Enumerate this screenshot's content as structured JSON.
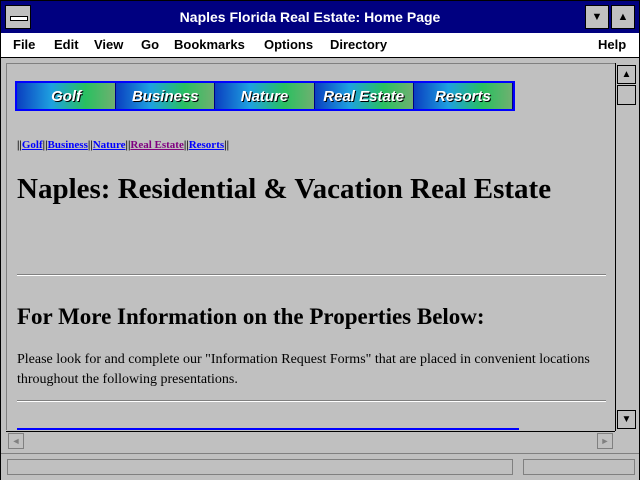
{
  "window": {
    "title": "Naples Florida Real Estate: Home Page",
    "min_glyph": "▼",
    "max_glyph": "▲"
  },
  "menu": [
    "File",
    "Edit",
    "View",
    "Go",
    "Bookmarks",
    "Options",
    "Directory",
    "Help"
  ],
  "banner": [
    "Golf",
    "Business",
    "Nature",
    "Real Estate",
    "Resorts"
  ],
  "textnav": {
    "sep": "||",
    "links": [
      "Golf",
      "Business",
      "Nature",
      "Real Estate",
      "Resorts"
    ]
  },
  "page": {
    "heading": "Naples: Residential & Vacation Real Estate",
    "subheading": "For More Information on the Properties Below:",
    "paragraph": "Please look for and complete our \"Information Request Forms\" that are placed in convenient locations throughout the following presentations."
  },
  "scroll": {
    "up": "▲",
    "down": "▼",
    "left": "◄",
    "right": "►"
  }
}
